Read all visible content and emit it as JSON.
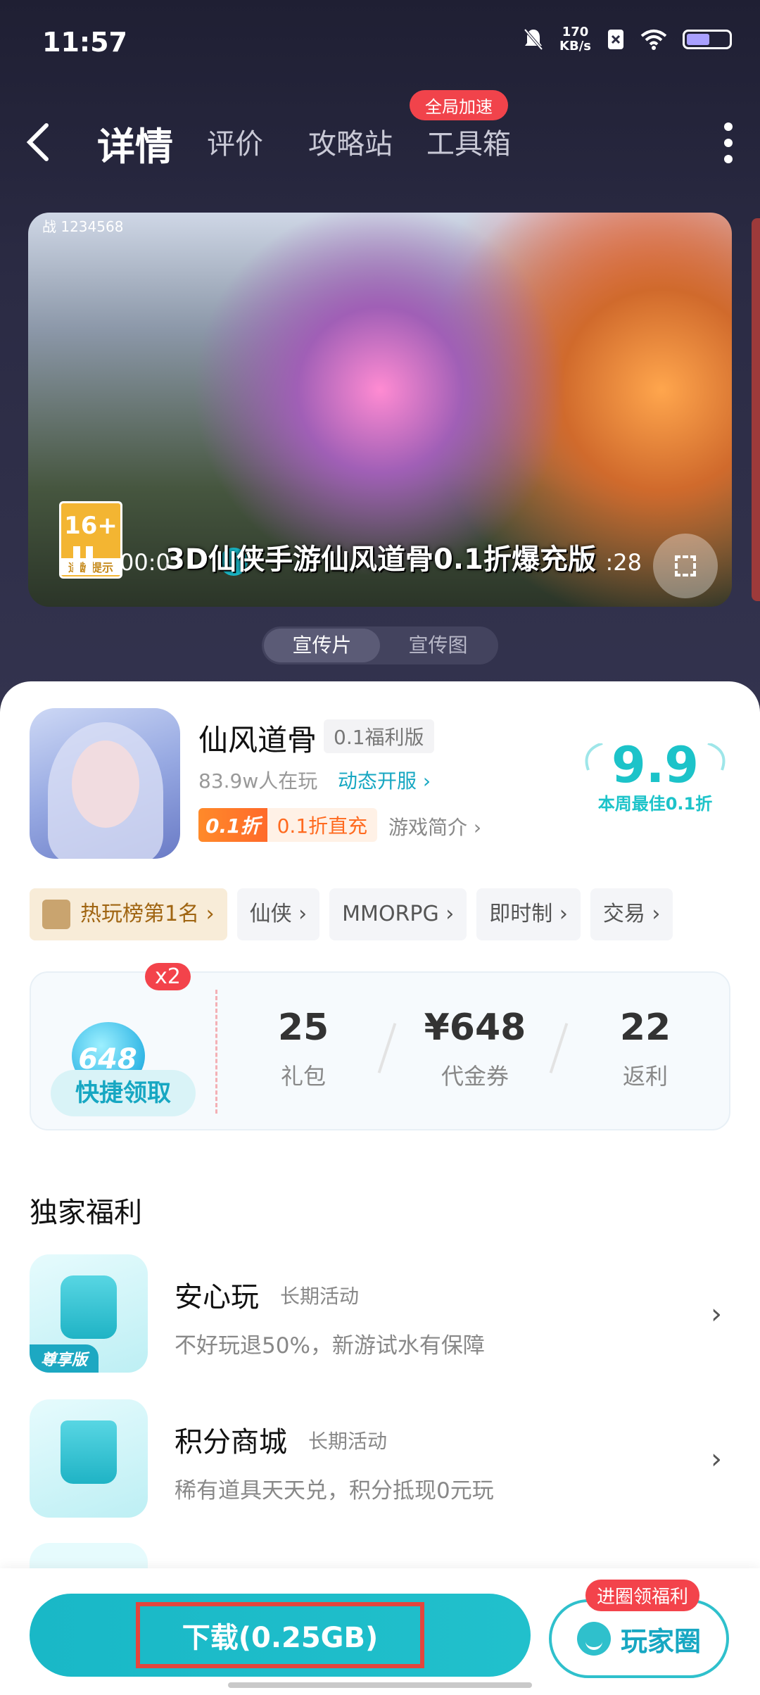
{
  "status": {
    "time": "11:57",
    "speed_value": "170",
    "speed_unit": "KB/s"
  },
  "nav": {
    "tabs": [
      {
        "label": "详情",
        "active": true
      },
      {
        "label": "评价"
      },
      {
        "label": "攻略站"
      },
      {
        "label": "工具箱"
      }
    ],
    "toolbox_badge": "全局加速"
  },
  "video": {
    "hud_text": "战 1234568",
    "age_rating": "16+",
    "age_label": "适龄提示",
    "time_start": "00:0",
    "time_end": ":28",
    "title": "3D仙侠手游仙风道骨0.1折爆充版"
  },
  "media_toggle": {
    "options": [
      "宣传片",
      "宣传图"
    ],
    "selected": "宣传片"
  },
  "game": {
    "name": "仙风道骨",
    "edition": "0.1福利版",
    "players": "83.9w人在玩",
    "dynamic_link": "动态开服 ›",
    "discount_badge": "0.1折",
    "discount_text": "0.1折直充",
    "intro_link": "游戏简介 ›",
    "score": "9.9",
    "score_label": "本周最佳0.1折"
  },
  "tags": [
    "热玩榜第1名 ›",
    "仙侠 ›",
    "MMORPG ›",
    "即时制 ›",
    "交易 ›"
  ],
  "benefits": {
    "multiplier": "x2",
    "bag_value": "648",
    "quick_claim": "快捷领取",
    "stats": [
      {
        "value": "25",
        "label": "礼包"
      },
      {
        "value": "¥648",
        "label": "代金券"
      },
      {
        "value": "22",
        "label": "返利"
      }
    ]
  },
  "exclusive": {
    "title": "独家福利",
    "items": [
      {
        "name": "安心玩",
        "duration": "长期活动",
        "desc": "不好玩退50%，新游试水有保障",
        "icon_tag": "尊享版"
      },
      {
        "name": "积分商城",
        "duration": "长期活动",
        "desc": "稀有道具天天兑，积分抵现0元玩"
      }
    ]
  },
  "bottom": {
    "download": "下载(0.25GB)",
    "circle": "玩家圈",
    "circle_badge": "进圈领福利"
  }
}
